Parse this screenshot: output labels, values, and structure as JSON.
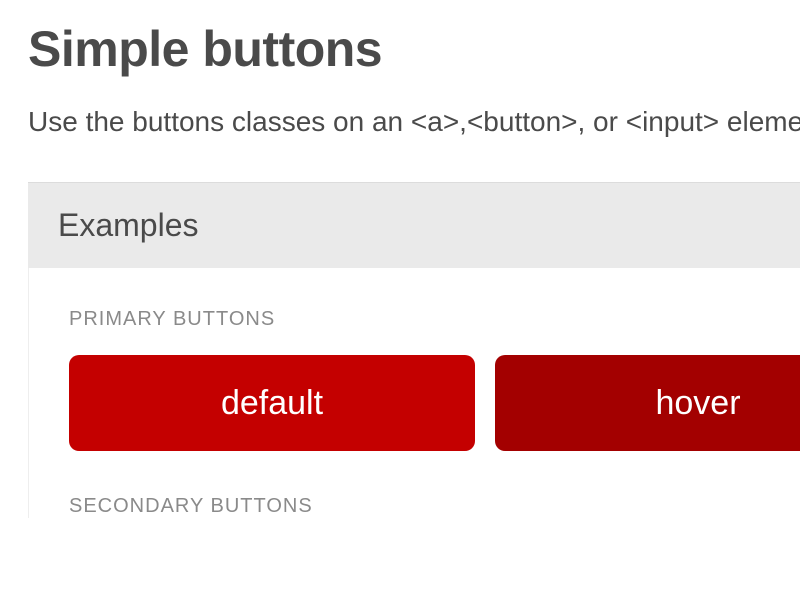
{
  "heading": "Simple buttons",
  "lead": "Use the buttons classes on an <a>,<button>, or <input> element.",
  "panel": {
    "title": "Examples",
    "primary_label": "PRIMARY BUTTONS",
    "secondary_label": "SECONDARY BUTTONS",
    "buttons": {
      "default": "default",
      "hover": "hover"
    }
  }
}
